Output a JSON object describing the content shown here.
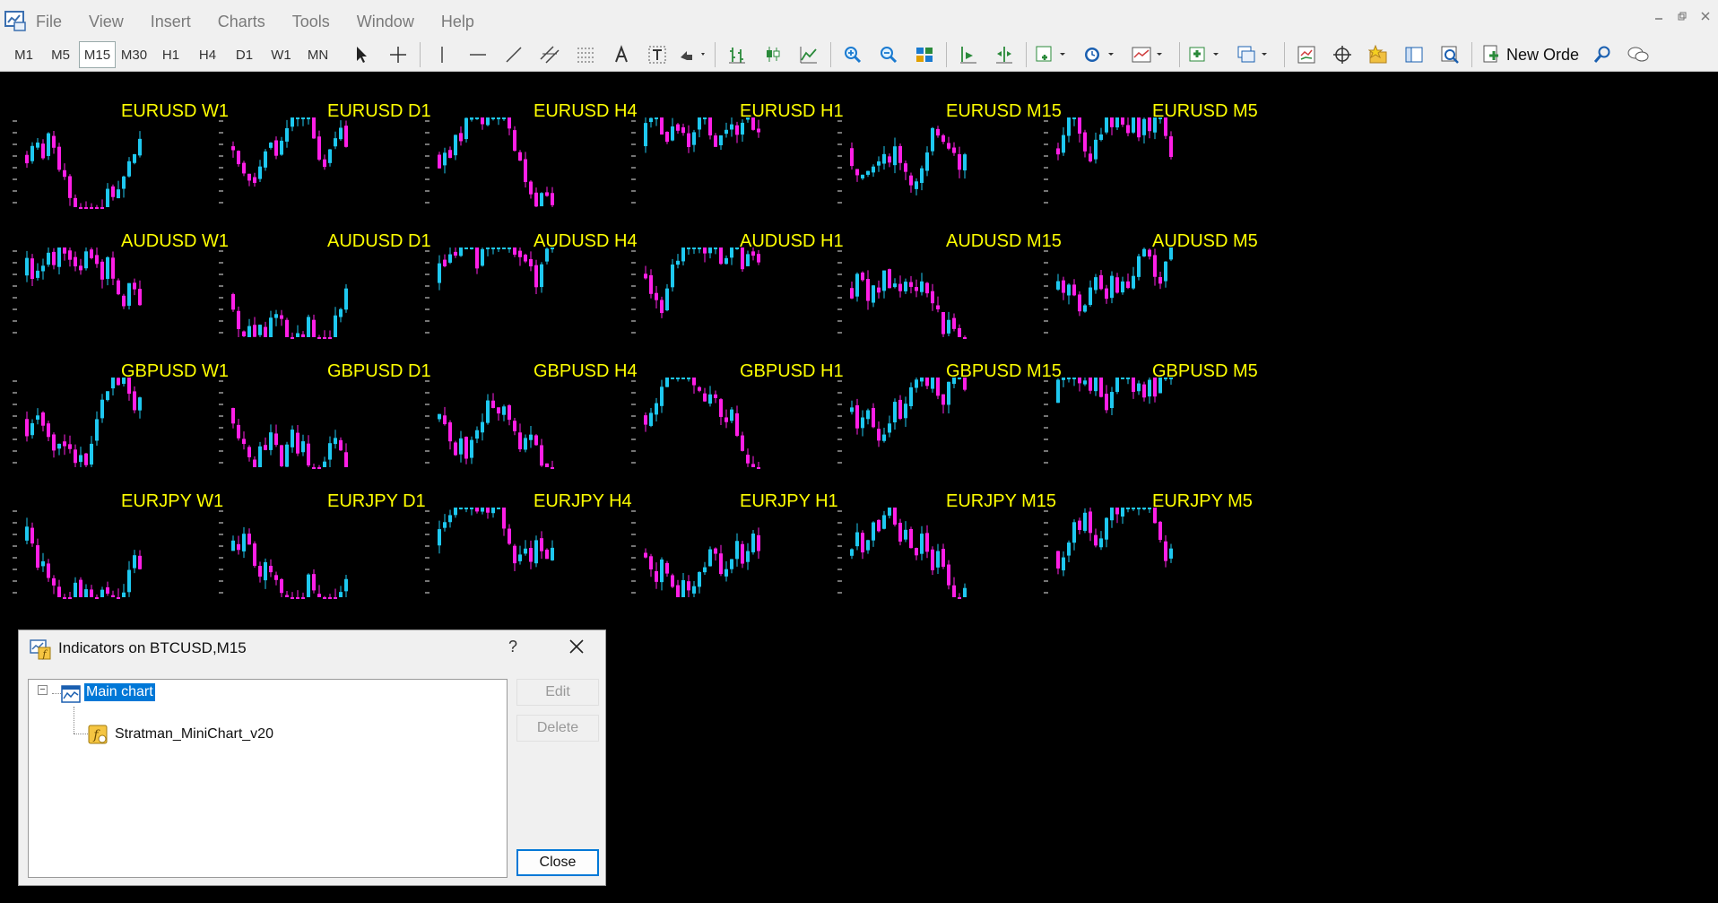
{
  "menubar": {
    "items": [
      "File",
      "View",
      "Insert",
      "Charts",
      "Tools",
      "Window",
      "Help"
    ]
  },
  "toolbar": {
    "timeframes": [
      "M1",
      "M5",
      "M15",
      "M30",
      "H1",
      "H4",
      "D1",
      "W1",
      "MN"
    ],
    "active_timeframe": "M15",
    "new_order_label": "New Orde"
  },
  "charts": {
    "up_color": "#1ec8f0",
    "down_color": "#ff1fe6",
    "title_color": "#ffff00",
    "rows": [
      [
        "EURUSD W1",
        "EURUSD D1",
        "EURUSD H4",
        "EURUSD H1",
        "EURUSD M15",
        "EURUSD M5"
      ],
      [
        "AUDUSD W1",
        "AUDUSD D1",
        "AUDUSD H4",
        "AUDUSD H1",
        "AUDUSD M15",
        "AUDUSD M5"
      ],
      [
        "GBPUSD W1",
        "GBPUSD D1",
        "GBPUSD H4",
        "GBPUSD H1",
        "GBPUSD M15",
        "GBPUSD M5"
      ],
      [
        "EURJPY W1",
        "EURJPY D1",
        "EURJPY H4",
        "EURJPY H1",
        "EURJPY M15",
        "EURJPY M5"
      ]
    ]
  },
  "dialog": {
    "title": "Indicators on BTCUSD,M15",
    "help_glyph": "?",
    "tree": {
      "root_label": "Main chart",
      "root_expander": "−",
      "child_label": "Stratman_MiniChart_v20"
    },
    "buttons": {
      "edit": "Edit",
      "delete": "Delete",
      "close": "Close"
    }
  }
}
